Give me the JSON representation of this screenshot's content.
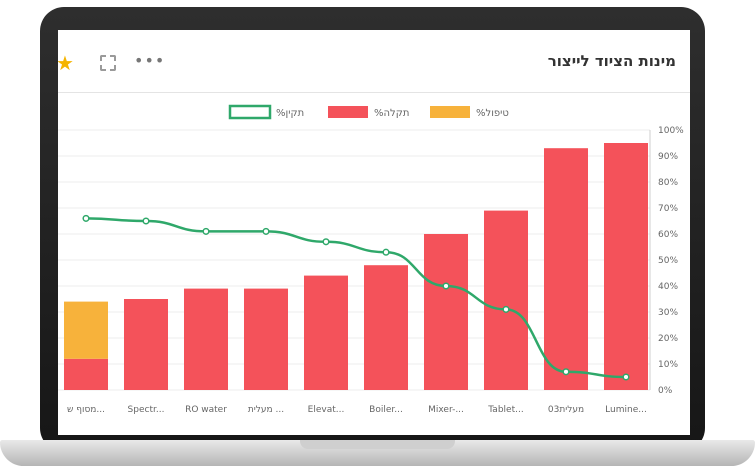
{
  "panel": {
    "title": "מינות הציוד לייצור",
    "star_icon": "star-icon",
    "expand_icon": "expand-icon",
    "more_icon": "more-icon"
  },
  "chart_data": {
    "type": "bar",
    "categories": [
      "מסוף ש...",
      "Spectr...",
      "RO water",
      "מעלית ...",
      "Elevat...",
      "Boiler...",
      "Mixer-...",
      "Tablet...",
      "מעלית03",
      "Lumine..."
    ],
    "series": [
      {
        "name": "%טיפול",
        "type": "bar",
        "color": "#f7b23b",
        "values": [
          22,
          0,
          0,
          0,
          0,
          0,
          0,
          0,
          0,
          0
        ]
      },
      {
        "name": "%תקלה",
        "type": "bar",
        "color": "#f4525a",
        "values": [
          12,
          35,
          39,
          39,
          44,
          48,
          60,
          69,
          93,
          95
        ]
      },
      {
        "name": "%תקין",
        "type": "line",
        "color": "#2fa86a",
        "values": [
          66,
          65,
          61,
          61,
          57,
          53,
          40,
          31,
          7,
          5
        ]
      }
    ],
    "ylim": [
      0,
      100
    ],
    "yticks": [
      "0%",
      "10%",
      "20%",
      "30%",
      "40%",
      "50%",
      "60%",
      "70%",
      "80%",
      "90%",
      "100%"
    ],
    "legend_position": "top",
    "grid": true,
    "stacked": true
  }
}
